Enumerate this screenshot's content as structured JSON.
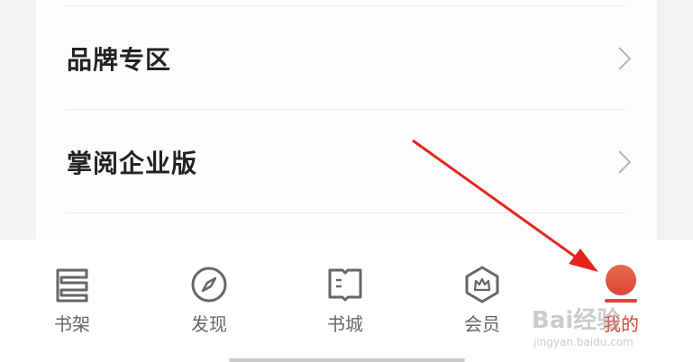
{
  "menu": {
    "items": [
      {
        "label": "品牌专区"
      },
      {
        "label": "掌阅企业版"
      }
    ]
  },
  "tabbar": {
    "tabs": [
      {
        "label": "书架",
        "icon": "bookshelf-icon"
      },
      {
        "label": "发现",
        "icon": "compass-icon"
      },
      {
        "label": "书城",
        "icon": "book-icon"
      },
      {
        "label": "会员",
        "icon": "crown-hexagon-icon"
      },
      {
        "label": "我的",
        "icon": "profile-icon",
        "active": true
      }
    ]
  },
  "watermark": {
    "text": "Bai经验",
    "sub": "jingyan.baidu.com"
  },
  "colors": {
    "accent": "#d9453a",
    "arrow": "#e8231c",
    "icon_gray": "#666666"
  }
}
